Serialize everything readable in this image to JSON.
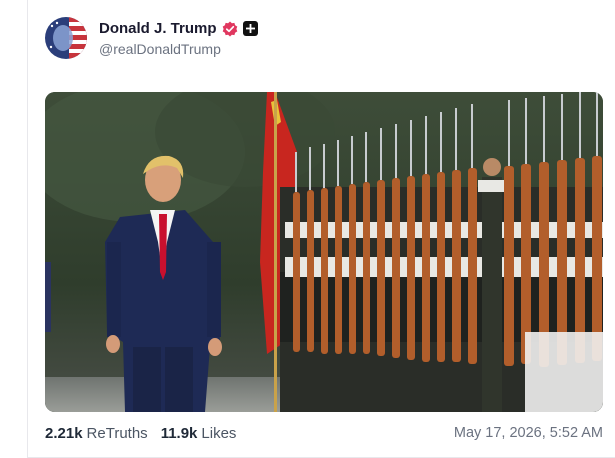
{
  "post": {
    "display_name": "Donald J. Trump",
    "handle": "@realDonaldTrump",
    "verified_icon": "verified-badge-icon",
    "plus_icon": "plus-badge-icon",
    "avatar_icon": "avatar-flag-portrait",
    "media_description_icon": "photo-honor-guard",
    "stats": {
      "retruths_count": "2.21k",
      "retruths_label": "ReTruths",
      "likes_count": "11.9k",
      "likes_label": "Likes"
    },
    "timestamp": "May 17, 2026, 5:52 AM"
  },
  "colors": {
    "verified": "#e0375f",
    "text_primary": "#1a1a2e",
    "text_secondary": "#6b7280"
  }
}
